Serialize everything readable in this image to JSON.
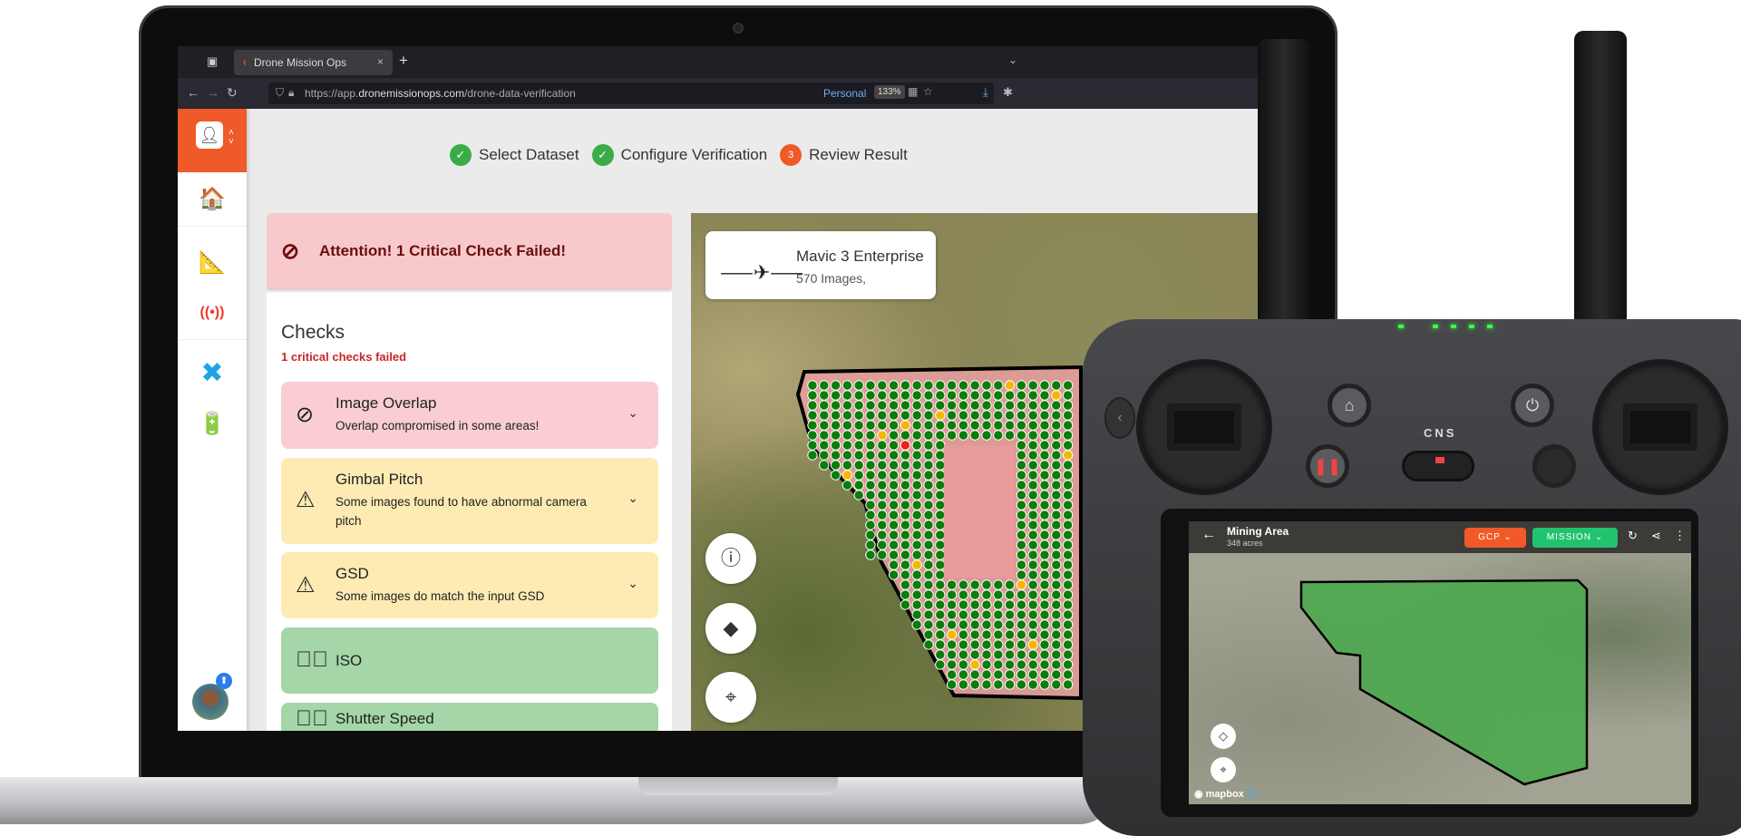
{
  "browser": {
    "tab_title": "Drone Mission Ops",
    "url_host": "https://app.",
    "url_domain": "dronemissionops.com",
    "url_path": "/drone-data-verification",
    "profile": "Personal",
    "zoom": "133%"
  },
  "stepper": [
    {
      "label": "Select Dataset",
      "state": "done"
    },
    {
      "label": "Configure Verification",
      "state": "done"
    },
    {
      "label": "Review Result",
      "number": "3",
      "state": "current"
    }
  ],
  "alert": {
    "text": "Attention! 1 Critical Check Failed!",
    "icon": "block-icon"
  },
  "checks": {
    "title": "Checks",
    "subtitle": "1 critical checks failed",
    "items": [
      {
        "title": "Image Overlap",
        "subtitle": "Overlap compromised in some areas!",
        "status": "critical"
      },
      {
        "title": "Gimbal Pitch",
        "subtitle": "Some images found to have abnormal camera pitch",
        "status": "warning"
      },
      {
        "title": "GSD",
        "subtitle": "Some images do match the input GSD",
        "status": "warning"
      },
      {
        "title": "ISO",
        "subtitle": "",
        "status": "pass"
      },
      {
        "title": "Shutter Speed",
        "subtitle": "",
        "status": "pass"
      }
    ]
  },
  "drone": {
    "name": "Mavic 3 Enterprise",
    "images": "570 Images,"
  },
  "controller": {
    "mode_label": "CNS",
    "mode_active": "N",
    "app": {
      "title": "Mining Area",
      "acres": "348 acres",
      "gcp_label": "GCP",
      "mission_label": "MISSION",
      "attribution": "mapbox"
    }
  },
  "colors": {
    "brand": "#f05a28",
    "done": "#3bab48",
    "critical": "#f9cdd2",
    "warning": "#fdebb3",
    "pass": "#a4d6a7",
    "mission": "#22c36f"
  }
}
